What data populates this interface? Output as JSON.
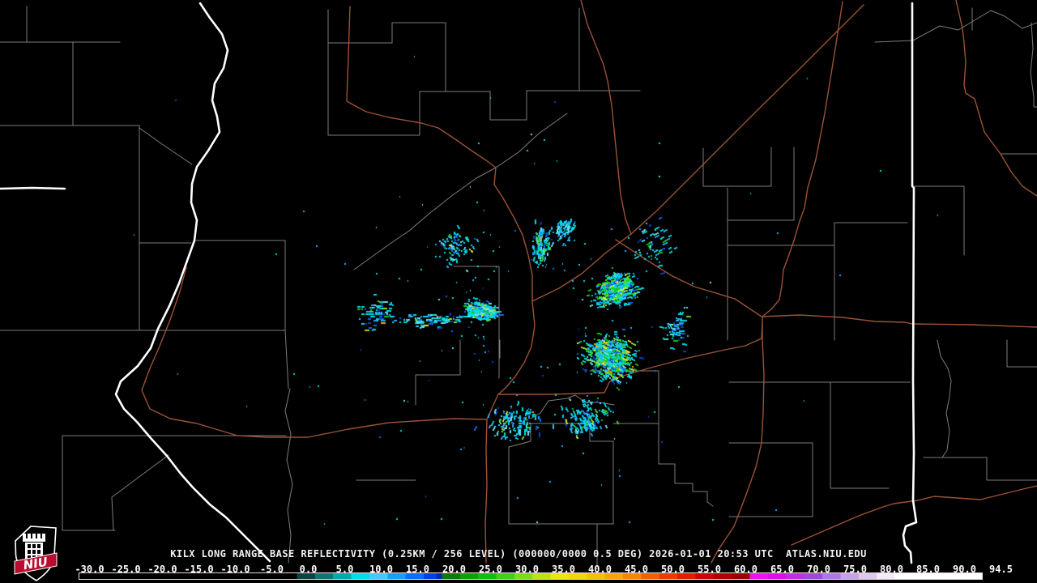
{
  "footer": {
    "title": "KILX LONG RANGE BASE REFLECTIVITY (0.25KM / 256 LEVEL) (000000/0000 0.5 DEG) 2026-01-01 20:53 UTC  ATLAS.NIU.EDU",
    "scale_labels": [
      "-30.0",
      "-25.0",
      "-20.0",
      "-15.0",
      "-10.0",
      "-5.0",
      "0.0",
      "5.0",
      "10.0",
      "15.0",
      "20.0",
      "25.0",
      "30.0",
      "35.0",
      "40.0",
      "45.0",
      "50.0",
      "55.0",
      "60.0",
      "65.0",
      "70.0",
      "75.0",
      "80.0",
      "85.0",
      "90.0",
      "94.5"
    ],
    "scale_min": -30,
    "scale_max": 94.5,
    "scale_segments": [
      {
        "v": -30,
        "c": "#000000"
      },
      {
        "v": 0,
        "c": "#0d4343"
      },
      {
        "v": 2.5,
        "c": "#117575"
      },
      {
        "v": 5,
        "c": "#00aaaa"
      },
      {
        "v": 7.5,
        "c": "#00e0e0"
      },
      {
        "v": 10,
        "c": "#48c8f8"
      },
      {
        "v": 12.5,
        "c": "#18a0f8"
      },
      {
        "v": 15,
        "c": "#0870f8"
      },
      {
        "v": 17.5,
        "c": "#0040e8"
      },
      {
        "v": 19.2,
        "c": "#0028b8"
      },
      {
        "v": 20,
        "c": "#0c7a0c"
      },
      {
        "v": 22.5,
        "c": "#0da00d"
      },
      {
        "v": 25,
        "c": "#12bd12"
      },
      {
        "v": 27.5,
        "c": "#3ed01c"
      },
      {
        "v": 30,
        "c": "#7edc16"
      },
      {
        "v": 32.5,
        "c": "#bce414"
      },
      {
        "v": 35,
        "c": "#ece80e"
      },
      {
        "v": 37.5,
        "c": "#f0d60a"
      },
      {
        "v": 40,
        "c": "#f2c208"
      },
      {
        "v": 42.5,
        "c": "#f2a806"
      },
      {
        "v": 45,
        "c": "#f08c04"
      },
      {
        "v": 47.5,
        "c": "#ee6203"
      },
      {
        "v": 50,
        "c": "#ec3a02"
      },
      {
        "v": 52.5,
        "c": "#e41a01"
      },
      {
        "v": 55,
        "c": "#cc0600"
      },
      {
        "v": 57.5,
        "c": "#b20000"
      },
      {
        "v": 60,
        "c": "#970000"
      },
      {
        "v": 62.5,
        "c": "#ee12ee"
      },
      {
        "v": 65,
        "c": "#da10ea"
      },
      {
        "v": 67.5,
        "c": "#bc30e4"
      },
      {
        "v": 70,
        "c": "#9c4ad8"
      },
      {
        "v": 72.5,
        "c": "#ae7ae2"
      },
      {
        "v": 75,
        "c": "#c6a2ea"
      },
      {
        "v": 77.5,
        "c": "#dec8f2"
      },
      {
        "v": 80,
        "c": "#f2ecfa"
      },
      {
        "v": 82.5,
        "c": "#ffffff"
      }
    ]
  },
  "logo": {
    "text": "NIU",
    "red": "#ba0c2f",
    "white": "#ffffff"
  },
  "map": {
    "background": "#000000",
    "county_color": "#7d7d7d",
    "state_color": "#ffffff",
    "road_color": "#9b5236",
    "counties": [
      [
        33,
        8,
        33,
        52
      ],
      [
        0,
        52,
        148,
        52
      ],
      [
        90,
        52,
        90,
        155
      ],
      [
        0,
        155,
        172,
        155
      ],
      [
        172,
        155,
        172,
        408,
        0,
        408
      ],
      [
        172,
        158,
        200,
        178,
        237,
        203
      ],
      [
        172,
        300,
        236,
        300
      ],
      [
        242,
        297,
        352,
        297,
        352,
        408
      ],
      [
        172,
        408,
        352,
        408
      ],
      [
        352,
        408,
        356,
        480
      ],
      [
        358,
        480,
        352,
        508,
        359,
        536,
        354,
        568,
        361,
        598,
        355,
        630,
        359,
        661,
        356,
        695
      ],
      [
        77,
        538,
        353,
        538
      ],
      [
        77,
        538,
        77,
        655,
        142,
        655
      ],
      [
        208,
        562,
        138,
        614,
        140,
        655
      ],
      [
        405,
        12,
        405,
        167
      ],
      [
        405,
        53,
        484,
        53,
        484,
        28,
        550,
        28
      ],
      [
        550,
        28,
        550,
        113
      ],
      [
        518,
        113,
        605,
        113
      ],
      [
        518,
        113,
        518,
        167,
        405,
        167
      ],
      [
        605,
        113,
        605,
        148,
        650,
        148,
        650,
        112,
        715,
        112,
        715,
        10
      ],
      [
        715,
        112,
        790,
        112
      ],
      [
        700,
        140,
        665,
        165,
        640,
        188,
        612,
        207,
        588,
        220,
        560,
        240,
        532,
        262,
        505,
        285,
        480,
        302,
        455,
        320,
        437,
        333
      ],
      [
        560,
        329,
        616,
        329,
        616,
        467
      ],
      [
        568,
        420,
        568,
        463,
        513,
        463,
        513,
        500
      ],
      [
        617,
        420,
        617,
        442
      ],
      [
        655,
        517,
        667,
        510,
        677,
        495,
        700,
        492,
        710,
        488,
        723,
        497,
        740,
        497,
        758,
        500
      ],
      [
        655,
        523,
        728,
        523,
        728,
        545,
        757,
        545,
        757,
        647,
        628,
        647,
        628,
        552,
        655,
        545,
        655,
        523
      ],
      [
        728,
        458,
        813,
        458,
        813,
        523
      ],
      [
        757,
        523,
        813,
        523
      ],
      [
        813,
        523,
        813,
        573,
        833,
        573,
        833,
        597,
        855,
        597,
        855,
        607,
        873,
        607,
        873,
        620,
        880,
        625
      ],
      [
        737,
        647,
        737,
        700
      ],
      [
        440,
        593,
        513,
        593
      ],
      [
        868,
        183,
        868,
        230,
        952,
        230,
        952,
        182
      ],
      [
        980,
        182,
        980,
        272,
        898,
        272
      ],
      [
        898,
        232,
        898,
        420
      ],
      [
        898,
        303,
        1030,
        303
      ],
      [
        1030,
        275,
        1030,
        420
      ],
      [
        1030,
        275,
        1120,
        275
      ],
      [
        900,
        472,
        1123,
        472
      ],
      [
        1025,
        472,
        1025,
        603,
        1097,
        603
      ],
      [
        900,
        547,
        1003,
        547,
        1003,
        638,
        900,
        638
      ],
      [
        1080,
        52,
        1127,
        50,
        1160,
        32,
        1183,
        37,
        1223,
        13,
        1240,
        20,
        1262,
        35,
        1280,
        28
      ],
      [
        1200,
        10,
        1200,
        37
      ],
      [
        1273,
        28,
        1275,
        60,
        1272,
        90,
        1276,
        120,
        1276,
        132,
        1280,
        132
      ],
      [
        1235,
        190,
        1280,
        190
      ],
      [
        1127,
        230,
        1190,
        230,
        1190,
        315
      ],
      [
        1243,
        420,
        1243,
        453,
        1280,
        453
      ],
      [
        1157,
        420,
        1161,
        440,
        1170,
        455,
        1174,
        470,
        1172,
        490,
        1168,
        510,
        1172,
        532,
        1169,
        556,
        1163,
        565
      ],
      [
        1140,
        565,
        1218,
        565,
        1218,
        593,
        1280,
        593
      ]
    ],
    "states": [
      [
        247,
        4,
        259,
        22,
        274,
        42,
        281,
        62,
        276,
        84,
        265,
        103,
        262,
        124,
        268,
        144,
        271,
        163,
        257,
        186,
        243,
        206,
        237,
        227,
        236,
        250,
        243,
        272,
        240,
        297,
        231,
        322,
        221,
        350,
        209,
        378,
        195,
        406,
        186,
        430,
        170,
        452,
        149,
        471,
        143,
        487,
        153,
        505,
        169,
        521,
        186,
        541,
        206,
        563,
        223,
        585,
        238,
        602,
        259,
        623,
        279,
        639,
        299,
        659,
        319,
        679,
        333,
        693
      ],
      [
        0,
        233,
        40,
        232,
        80,
        233
      ],
      [
        1126,
        4,
        1126,
        230,
        1128,
        232,
        1127,
        470,
        1128,
        560,
        1127,
        618,
        1131,
        645,
        1118,
        650,
        1115,
        661,
        1117,
        674,
        1124,
        682,
        1125,
        695
      ]
    ],
    "roads": [
      [
        432,
        8,
        430,
        70,
        428,
        125,
        452,
        138,
        480,
        145,
        520,
        152,
        541,
        158,
        562,
        172,
        582,
        186,
        600,
        198,
        612,
        207,
        610,
        228,
        620,
        243,
        634,
        268,
        645,
        290,
        652,
        315,
        657,
        340,
        657,
        372
      ],
      [
        657,
        372,
        690,
        356,
        718,
        338,
        748,
        312,
        779,
        289,
        812,
        259,
        840,
        231,
        869,
        202,
        905,
        166,
        941,
        130,
        986,
        86,
        1031,
        41,
        1066,
        6
      ],
      [
        657,
        372,
        660,
        402,
        656,
        428,
        647,
        448,
        636,
        465,
        625,
        478,
        615,
        487,
        609,
        500,
        601,
        518,
        600,
        556,
        601,
        600,
        599,
        648,
        600,
        695
      ],
      [
        615,
        487,
        680,
        487,
        746,
        485,
        752,
        472,
        766,
        465,
        800,
        455,
        845,
        443,
        890,
        433,
        920,
        427,
        940,
        418,
        941,
        400
      ],
      [
        760,
        296,
        798,
        321,
        830,
        341,
        857,
        354,
        907,
        369,
        940,
        391
      ],
      [
        1040,
        2,
        1031,
        60,
        1018,
        140,
        1007,
        197,
        997,
        232,
        993,
        257,
        987,
        273,
        980,
        297,
        972,
        320,
        967,
        333,
        965,
        353,
        962,
        370,
        953,
        381,
        941,
        391,
        941,
        420,
        943,
        463,
        942,
        510,
        940,
        547,
        933,
        577,
        922,
        608,
        913,
        632,
        906,
        650,
        898,
        662,
        886,
        680,
        878,
        695
      ],
      [
        941,
        391,
        987,
        389,
        1040,
        392,
        1080,
        397,
        1117,
        398,
        1126,
        400,
        1200,
        401,
        1280,
        404
      ],
      [
        977,
        673,
        1023,
        653,
        1060,
        637,
        1087,
        627,
        1103,
        622,
        1133,
        618,
        1153,
        613,
        1210,
        617,
        1267,
        603,
        1280,
        600
      ],
      [
        230,
        330,
        222,
        360,
        210,
        395,
        196,
        430,
        185,
        455,
        175,
        482,
        185,
        505,
        210,
        517,
        243,
        523,
        293,
        538,
        330,
        540,
        380,
        540,
        430,
        530,
        480,
        522,
        560,
        517,
        600,
        518
      ],
      [
        1180,
        0,
        1188,
        35,
        1190,
        53,
        1192,
        77,
        1190,
        105,
        1192,
        115,
        1203,
        122,
        1215,
        163,
        1220,
        170,
        1235,
        190,
        1248,
        212,
        1262,
        230,
        1280,
        242
      ],
      [
        717,
        0,
        725,
        30,
        735,
        55,
        745,
        80,
        750,
        100,
        755,
        130,
        758,
        160,
        762,
        200,
        766,
        240,
        772,
        270,
        779,
        289
      ]
    ]
  },
  "echoes": {
    "site": [
      656,
      390
    ],
    "seed": 11,
    "base_palette": [
      [
        "#00dce8",
        50
      ],
      [
        "#72e2f2",
        12
      ],
      [
        "#2aaaf8",
        20
      ],
      [
        "#0a6af2",
        10
      ],
      [
        "#0a42c4",
        8
      ]
    ],
    "hot_palette": [
      [
        "#16c616",
        42
      ],
      [
        "#52dc2a",
        20
      ],
      [
        "#a2e01a",
        14
      ],
      [
        "#ecec24",
        10
      ],
      [
        "#f8a400",
        5
      ],
      [
        "#12e2c2",
        9
      ]
    ],
    "clusters": [
      {
        "angle": 186,
        "aspread": 9,
        "radius": 62,
        "rspread": 20,
        "count": 330,
        "hot": 0.3
      },
      {
        "angle": 178,
        "aspread": 4,
        "radius": 125,
        "rspread": 38,
        "count": 85,
        "hot": 0.15
      },
      {
        "angle": -17,
        "aspread": 10,
        "radius": 108,
        "rspread": 26,
        "count": 420,
        "hot": 0.33
      },
      {
        "angle": 28,
        "aspread": 13,
        "radius": 108,
        "rspread": 30,
        "count": 560,
        "hot": 0.42
      },
      {
        "angle": -83,
        "aspread": 7,
        "radius": 88,
        "rspread": 20,
        "count": 130,
        "hot": 0.28
      },
      {
        "angle": 181,
        "aspread": 5,
        "radius": 190,
        "rspread": 24,
        "count": 85,
        "hot": 0.1
      },
      {
        "angle": 98,
        "aspread": 16,
        "radius": 132,
        "rspread": 22,
        "count": 120,
        "hot": 0.1
      },
      {
        "angle": 62,
        "aspread": 13,
        "radius": 142,
        "rspread": 22,
        "count": 140,
        "hot": 0.12
      },
      {
        "angle": 4,
        "aspread": 7,
        "radius": 178,
        "rspread": 16,
        "count": 60,
        "hot": 0.1
      },
      {
        "angle": -137,
        "aspread": 12,
        "radius": 128,
        "rspread": 20,
        "count": 70,
        "hot": 0.1
      },
      {
        "angle": -70,
        "aspread": 6,
        "radius": 112,
        "rspread": 15,
        "count": 60,
        "hot": 0.15
      },
      {
        "angle": -30,
        "aspread": 8,
        "radius": 172,
        "rspread": 25,
        "count": 55,
        "hot": 0.12
      }
    ],
    "scatter": {
      "count": 190,
      "rmin": 60,
      "rmax": 540
    }
  }
}
